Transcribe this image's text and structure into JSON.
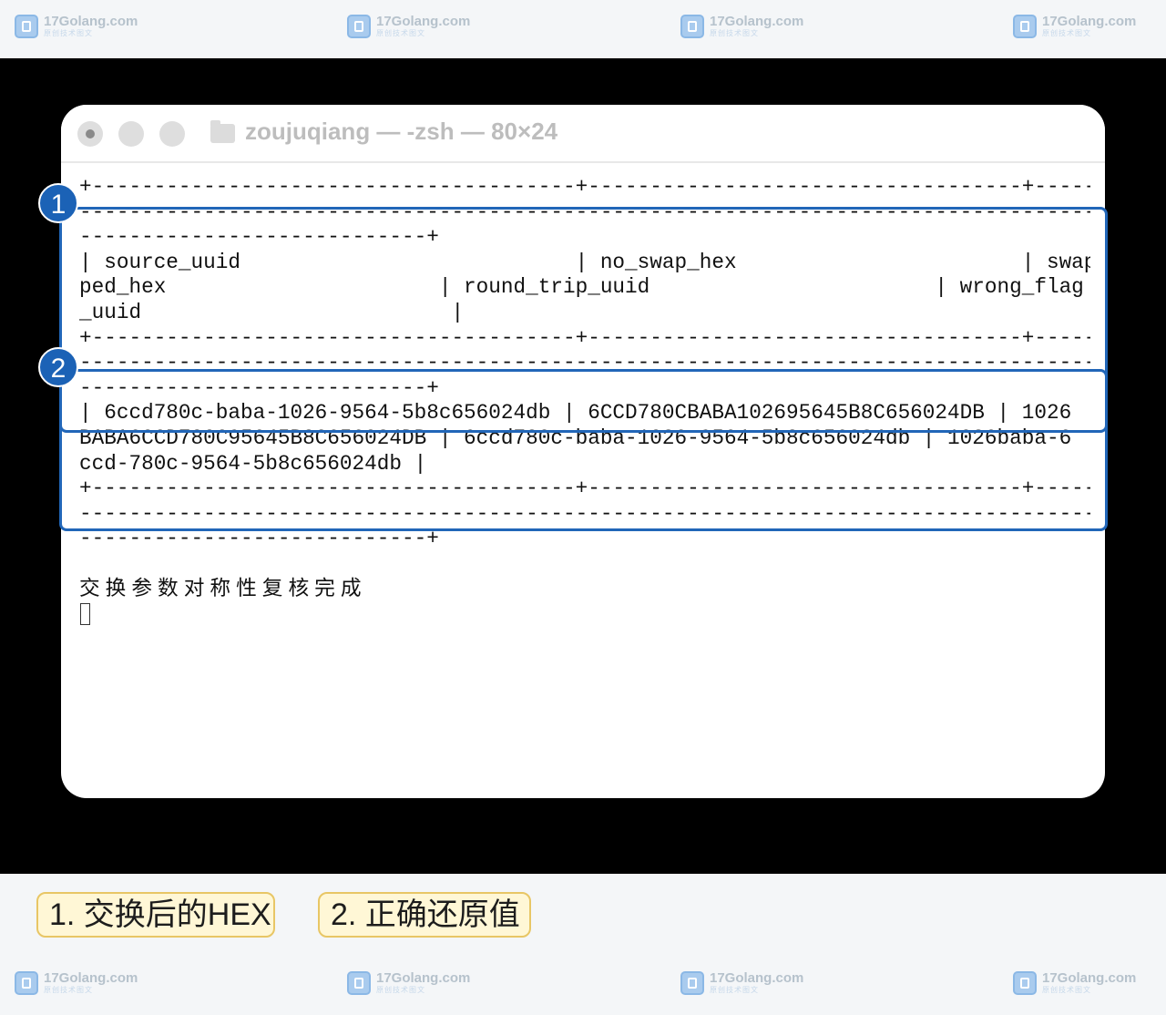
{
  "watermark": {
    "site": "17Golang.com",
    "tagline": "原创技术图文"
  },
  "window": {
    "title": "zoujuqiang — -zsh — 80×24"
  },
  "terminal": {
    "lines": [
      "+---------------------------------------+-----------------------------------+-----",
      "---------------------------------------------------------------------------------------",
      "----------------------------+",
      "| source_uuid                           | no_swap_hex                       | swap",
      "ped_hex                      | round_trip_uuid                       | wrong_flag",
      "_uuid                         |",
      "+---------------------------------------+-----------------------------------+-----",
      "---------------------------------------------------------------------------------------",
      "----------------------------+",
      "| 6ccd780c-baba-1026-9564-5b8c656024db | 6CCD780CBABA102695645B8C656024DB | 1026",
      "BABA6CCD780C95645B8C656024DB | 6ccd780c-baba-1026-9564-5b8c656024db | 1026baba-6",
      "ccd-780c-9564-5b8c656024db |",
      "+---------------------------------------+-----------------------------------+-----",
      "---------------------------------------------------------------------------------------",
      "----------------------------+",
      "",
      "交换参数对称性复核完成"
    ]
  },
  "highlights": [
    {
      "number": "1"
    },
    {
      "number": "2"
    }
  ],
  "legend": {
    "item1": "1. 交换后的HEX",
    "item2": "2. 正确还原值"
  },
  "colors": {
    "highlight_border": "#2166b8",
    "badge_fill": "#1b62b6",
    "legend_fill": "#fff7d6",
    "legend_border": "#e8c665",
    "stage_background": "#000000"
  }
}
